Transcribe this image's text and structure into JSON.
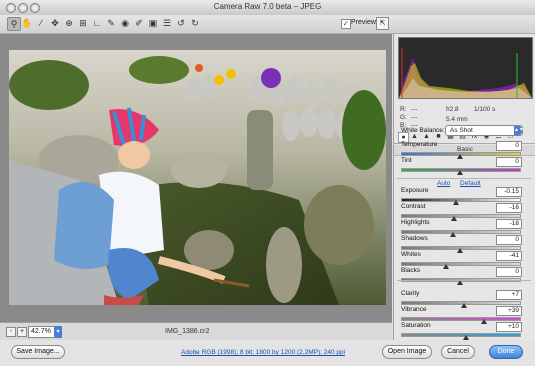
{
  "window": {
    "title": "Camera Raw 7.0 beta  –  JPEG"
  },
  "toolbar": {
    "tools": [
      "zoom-tool",
      "hand-tool",
      "white-balance-tool",
      "color-sampler-tool",
      "targeted-adjustment-tool",
      "crop-tool",
      "straighten-tool",
      "spot-removal-tool",
      "red-eye-tool",
      "adjustment-brush-tool",
      "graduated-filter-tool",
      "radial-filter-tool",
      "preferences",
      "rotate-left",
      "rotate-right"
    ],
    "preview_label": "Preview",
    "preview_checked": true
  },
  "zoom": {
    "minus": "-",
    "plus": "+",
    "value": "42.7%"
  },
  "filename": "IMG_1386.cr2",
  "workflow_link": "Adobe RGB (1998); 8 bit; 1800 by 1200 (2.2MP); 240 ppi",
  "buttons": {
    "save": "Save Image...",
    "open": "Open Image",
    "cancel": "Cancel",
    "done": "Done"
  },
  "readout": {
    "r_label": "R:",
    "g_label": "G:",
    "b_label": "B:",
    "r_value": "---",
    "g_value": "---",
    "b_value": "---",
    "aperture": "f/2.8",
    "shutter": "1/100 s",
    "focal": "5.4 mm"
  },
  "panel": {
    "title": "Basic",
    "white_balance_label": "White Balance:",
    "white_balance_value": "As Shot",
    "auto": "Auto",
    "default": "Default",
    "sliders": [
      {
        "label": "Temperature",
        "value": "0"
      },
      {
        "label": "Tint",
        "value": "0"
      },
      {
        "label": "Exposure",
        "value": "-0.15"
      },
      {
        "label": "Contrast",
        "value": "-16"
      },
      {
        "label": "Highlights",
        "value": "-18"
      },
      {
        "label": "Shadows",
        "value": "0"
      },
      {
        "label": "Whites",
        "value": "-41"
      },
      {
        "label": "Blacks",
        "value": "0"
      },
      {
        "label": "Clarity",
        "value": "+7"
      },
      {
        "label": "Vibrance",
        "value": "+39"
      },
      {
        "label": "Saturation",
        "value": "+10"
      }
    ]
  },
  "colors": {
    "default_button": "#3a83dd",
    "link": "#1c4fb5"
  }
}
